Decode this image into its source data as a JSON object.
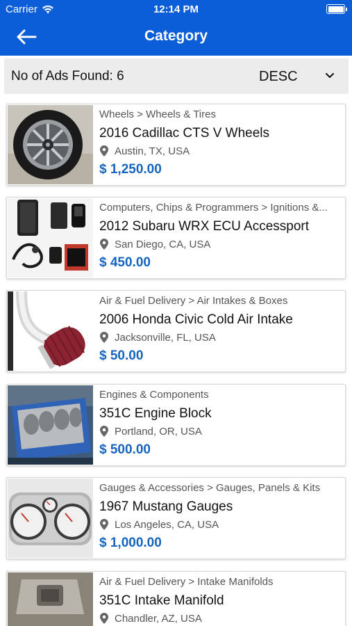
{
  "status_bar": {
    "carrier": "Carrier",
    "time": "12:14 PM"
  },
  "nav": {
    "title": "Category",
    "back_icon": "arrow-left-icon"
  },
  "filter": {
    "ads_found": "No of Ads Found: 6",
    "sort_order": "DESC"
  },
  "colors": {
    "primary": "#0b5ed7",
    "price": "#1565c0",
    "filter_bg": "#ececec"
  },
  "ads": [
    {
      "category": "Wheels > Wheels & Tires",
      "title": "2016 Cadillac CTS V Wheels",
      "location": "Austin, TX, USA",
      "price": "$ 1,250.00",
      "image": "wheel"
    },
    {
      "category": "Computers, Chips & Programmers > Ignitions &...",
      "title": "2012 Subaru WRX ECU Accessport",
      "location": "San Diego, CA, USA",
      "price": "$ 450.00",
      "image": "ecu-kit"
    },
    {
      "category": "Air & Fuel Delivery > Air Intakes & Boxes",
      "title": "2006 Honda Civic Cold Air Intake",
      "location": "Jacksonville, FL, USA",
      "price": "$ 50.00",
      "image": "air-intake"
    },
    {
      "category": "Engines & Components",
      "title": "351C Engine Block",
      "location": "Portland, OR, USA",
      "price": "$ 500.00",
      "image": "engine-block"
    },
    {
      "category": "Gauges & Accessories > Gauges, Panels & Kits",
      "title": "1967 Mustang Gauges",
      "location": "Los Angeles, CA, USA",
      "price": "$ 1,000.00",
      "image": "gauges"
    },
    {
      "category": "Air & Fuel Delivery > Intake Manifolds",
      "title": "351C Intake Manifold",
      "location": "Chandler, AZ, USA",
      "price": "",
      "image": "intake-manifold"
    }
  ]
}
